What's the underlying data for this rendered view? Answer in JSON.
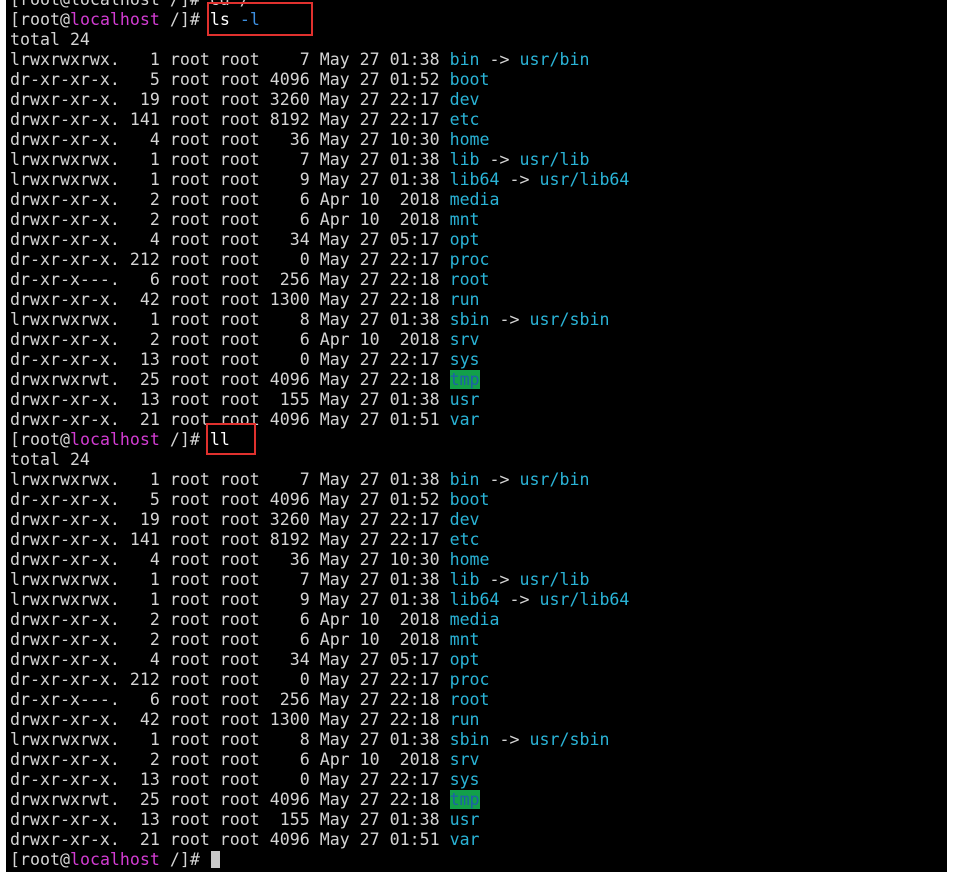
{
  "terminal": {
    "prompt": {
      "bracket_open": "[",
      "user": "root",
      "at": "@",
      "host": "localhost",
      "path": " /]#",
      "space": " "
    },
    "top_clipped_line": "[root@localhost /]# cd /",
    "command_1": {
      "name": "ls",
      "flag": "-l"
    },
    "command_2": {
      "name": "ll"
    },
    "total_line": "total 24",
    "listing": [
      {
        "meta": "lrwxrwxrwx.   1 root root    7 May 27 01:38 ",
        "name": "bin",
        "arrow": " -> ",
        "target": "usr/bin",
        "kind": "link"
      },
      {
        "meta": "dr-xr-xr-x.   5 root root 4096 May 27 01:52 ",
        "name": "boot",
        "kind": "dir"
      },
      {
        "meta": "drwxr-xr-x.  19 root root 3260 May 27 22:17 ",
        "name": "dev",
        "kind": "dir"
      },
      {
        "meta": "drwxr-xr-x. 141 root root 8192 May 27 22:17 ",
        "name": "etc",
        "kind": "dir"
      },
      {
        "meta": "drwxr-xr-x.   4 root root   36 May 27 10:30 ",
        "name": "home",
        "kind": "dir"
      },
      {
        "meta": "lrwxrwxrwx.   1 root root    7 May 27 01:38 ",
        "name": "lib",
        "arrow": " -> ",
        "target": "usr/lib",
        "kind": "link"
      },
      {
        "meta": "lrwxrwxrwx.   1 root root    9 May 27 01:38 ",
        "name": "lib64",
        "arrow": " -> ",
        "target": "usr/lib64",
        "kind": "link"
      },
      {
        "meta": "drwxr-xr-x.   2 root root    6 Apr 10  2018 ",
        "name": "media",
        "kind": "dir"
      },
      {
        "meta": "drwxr-xr-x.   2 root root    6 Apr 10  2018 ",
        "name": "mnt",
        "kind": "dir"
      },
      {
        "meta": "drwxr-xr-x.   4 root root   34 May 27 05:17 ",
        "name": "opt",
        "kind": "dir"
      },
      {
        "meta": "dr-xr-xr-x. 212 root root    0 May 27 22:17 ",
        "name": "proc",
        "kind": "dir"
      },
      {
        "meta": "dr-xr-x---.   6 root root  256 May 27 22:18 ",
        "name": "root",
        "kind": "dir"
      },
      {
        "meta": "drwxr-xr-x.  42 root root 1300 May 27 22:18 ",
        "name": "run",
        "kind": "dir"
      },
      {
        "meta": "lrwxrwxrwx.   1 root root    8 May 27 01:38 ",
        "name": "sbin",
        "arrow": " -> ",
        "target": "usr/sbin",
        "kind": "link"
      },
      {
        "meta": "drwxr-xr-x.   2 root root    6 Apr 10  2018 ",
        "name": "srv",
        "kind": "dir"
      },
      {
        "meta": "dr-xr-xr-x.  13 root root    0 May 27 22:17 ",
        "name": "sys",
        "kind": "dir"
      },
      {
        "meta": "drwxrwxrwt.  25 root root 4096 May 27 22:18 ",
        "name": "tmp",
        "kind": "sticky"
      },
      {
        "meta": "drwxr-xr-x.  13 root root  155 May 27 01:38 ",
        "name": "usr",
        "kind": "dir"
      },
      {
        "meta": "drwxr-xr-x.  21 root root 4096 May 27 01:51 ",
        "name": "var",
        "kind": "dir"
      }
    ]
  },
  "colors": {
    "background": "#000000",
    "text": "#d4d4d4",
    "host": "#d23cd2",
    "directory": "#2ab3d6",
    "flag": "#3d8fe0",
    "sticky_dir_background": "#12a04a",
    "highlight_box": "#e0312e"
  }
}
